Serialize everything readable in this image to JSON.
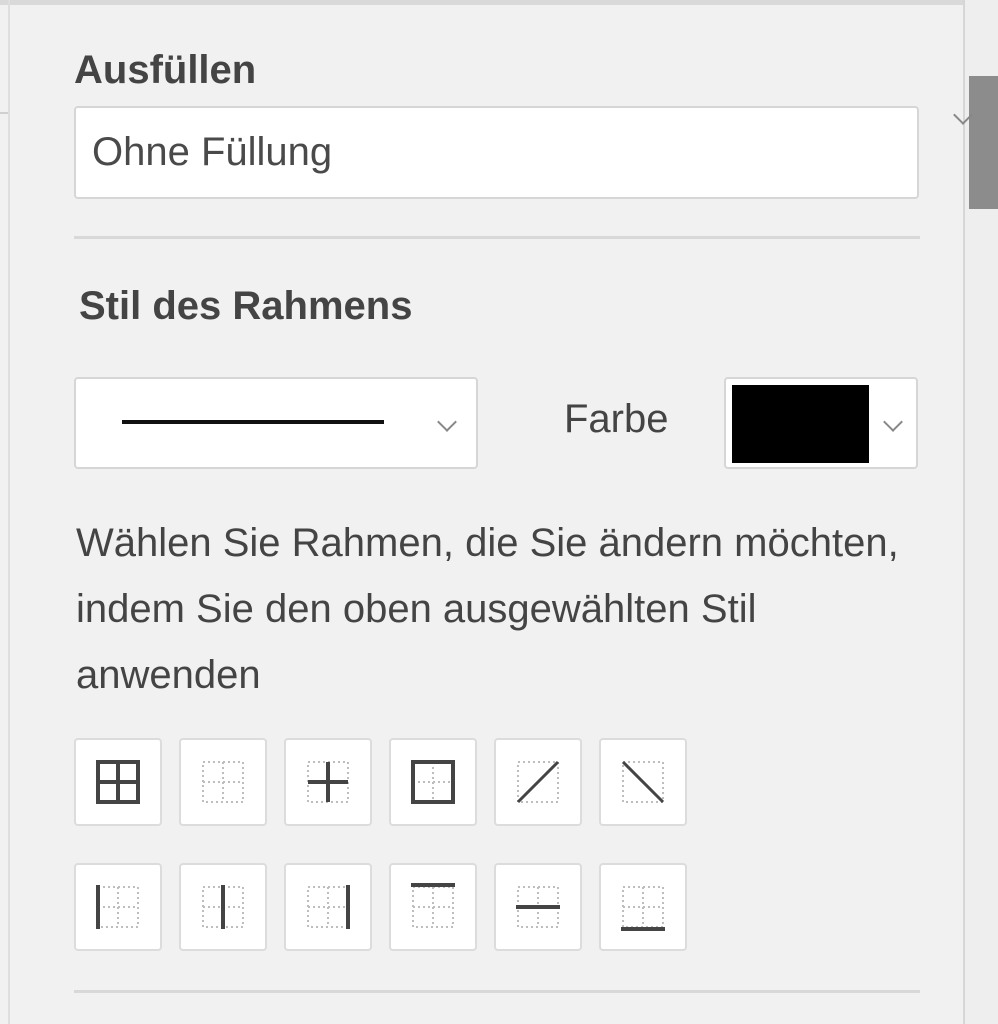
{
  "fill": {
    "label": "Ausfüllen",
    "selected": "Ohne Füllung"
  },
  "border": {
    "style_label": "Stil des Rahmens",
    "line_style": "solid",
    "color_label": "Farbe",
    "color": "#000000",
    "description": "Wählen Sie Rahmen, die Sie ändern möchten, indem Sie den oben ausgewählten Stil anwenden",
    "presets_row1": [
      {
        "name": "all-borders-icon"
      },
      {
        "name": "no-borders-icon"
      },
      {
        "name": "inner-borders-icon"
      },
      {
        "name": "outer-borders-icon"
      },
      {
        "name": "diagonal-up-border-icon"
      },
      {
        "name": "diagonal-down-border-icon"
      }
    ],
    "presets_row2": [
      {
        "name": "left-border-icon"
      },
      {
        "name": "inner-vertical-border-icon"
      },
      {
        "name": "right-border-icon"
      },
      {
        "name": "top-border-icon"
      },
      {
        "name": "inner-horizontal-border-icon"
      },
      {
        "name": "bottom-border-icon"
      }
    ]
  }
}
